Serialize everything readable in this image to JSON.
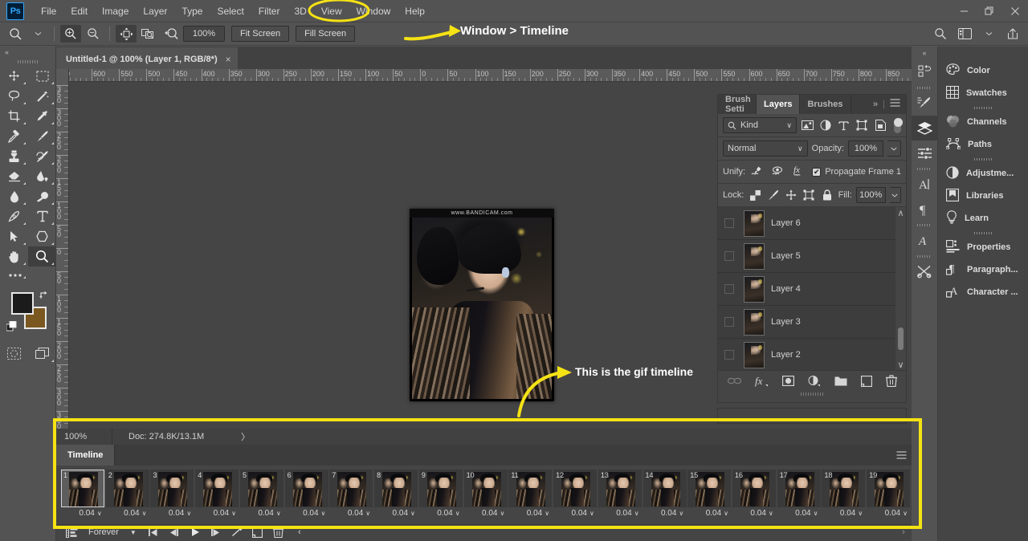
{
  "app": {
    "logo": "Ps"
  },
  "menubar": {
    "items": [
      "File",
      "Edit",
      "Image",
      "Layer",
      "Type",
      "Select",
      "Filter",
      "3D",
      "View",
      "Window",
      "Help"
    ],
    "highlighted": "Window",
    "window_controls": [
      "minimize",
      "restore",
      "close"
    ]
  },
  "options_bar": {
    "tool_icon": "zoom-tool-icon",
    "zoom_in": "zoom-in-icon",
    "zoom_out": "zoom-out-icon",
    "resize_windows": "resize-windows-icon",
    "zoom_all_windows": "zoom-all-windows-icon",
    "scrubby_zoom": "scrubby-zoom-icon",
    "zoom_value": "100%",
    "fit_screen": "Fit Screen",
    "fill_screen": "Fill Screen",
    "right_icons": [
      "search-icon",
      "workspace-icon",
      "chevron-down-icon",
      "share-icon"
    ]
  },
  "toolbar": {
    "collapse": "«",
    "tools": [
      "move-tool-icon",
      "marquee-tool-icon",
      "lasso-tool-icon",
      "magic-wand-tool-icon",
      "crop-tool-icon",
      "eyedropper-tool-icon",
      "healing-brush-tool-icon",
      "brush-tool-icon",
      "clone-stamp-tool-icon",
      "history-brush-tool-icon",
      "eraser-tool-icon",
      "gradient-tool-icon",
      "blur-tool-icon",
      "dodge-tool-icon",
      "pen-tool-icon",
      "type-tool-icon",
      "path-selection-tool-icon",
      "shape-tool-icon",
      "hand-tool-icon",
      "zoom-tool-icon"
    ],
    "active_tool": "zoom-tool-icon",
    "more_tools": "edit-toolbar-icon",
    "foreground_color": "#1b1b1b",
    "background_color": "#7b5820",
    "quick_mask": "quick-mask-icon",
    "screen_mode": "screen-mode-icon"
  },
  "document": {
    "tab_title": "Untitled-1 @ 100% (Layer 1, RGB/8*)",
    "close_label": "×",
    "ruler_h_labels": [
      "0",
      "600",
      "550",
      "500",
      "450",
      "400",
      "350",
      "300",
      "250",
      "200",
      "150",
      "100",
      "50",
      "0",
      "50",
      "100",
      "150",
      "200",
      "250",
      "300",
      "350",
      "400",
      "450",
      "500",
      "550",
      "600",
      "650",
      "700",
      "750",
      "800",
      "850"
    ],
    "ruler_v_labels": [
      "350",
      "300",
      "250",
      "200",
      "150",
      "100",
      "50",
      "0",
      "50",
      "100",
      "150",
      "200",
      "250",
      "300",
      "350",
      "400"
    ],
    "watermark": "www.BANDICAM.com"
  },
  "layers_panel": {
    "tabs": [
      {
        "label": "Brush Setti",
        "active": false
      },
      {
        "label": "Layers",
        "active": true
      },
      {
        "label": "Brushes",
        "active": false
      }
    ],
    "overflow": "»",
    "menu_icon": "panel-menu-icon",
    "filter": {
      "search_icon": "search-icon",
      "kind_label": "Kind",
      "caret": "∨",
      "icons": [
        "filter-pixel-icon",
        "filter-adjustment-icon",
        "filter-type-icon",
        "filter-shape-icon",
        "filter-smart-object-icon"
      ],
      "toggle": "filter-enable-toggle"
    },
    "blend": {
      "mode": "Normal",
      "caret": "∨",
      "opacity_label": "Opacity:",
      "opacity_value": "100%"
    },
    "unify": {
      "label": "Unify:",
      "icons": [
        "unify-position-icon",
        "unify-visibility-icon",
        "unify-style-icon"
      ],
      "propagate_checked": true,
      "propagate_label": "Propagate Frame 1",
      "check_glyph": "✔"
    },
    "lock": {
      "label": "Lock:",
      "icons": [
        "lock-transparent-pixels-icon",
        "lock-image-pixels-icon",
        "lock-position-icon",
        "lock-artboard-nesting-icon",
        "lock-all-icon"
      ],
      "fill_label": "Fill:",
      "fill_value": "100%"
    },
    "layers": [
      {
        "name": "Layer 6",
        "selected": false
      },
      {
        "name": "Layer 5",
        "selected": false
      },
      {
        "name": "Layer 4",
        "selected": false
      },
      {
        "name": "Layer 3",
        "selected": false
      },
      {
        "name": "Layer 2",
        "selected": false
      },
      {
        "name": "",
        "selected": true
      }
    ],
    "footer_icons": [
      "link-layers-icon",
      "layer-style-fx-icon",
      "layer-mask-icon",
      "adjustment-layer-icon",
      "new-group-icon",
      "new-layer-icon",
      "delete-layer-icon"
    ],
    "scroll_up": "∧",
    "scroll_down": "∨"
  },
  "right_dock": {
    "collapse": "«",
    "icon_rail": [
      "history-icon",
      "brush-settings-icon",
      "layers-icon",
      "adjustments-icon",
      "character-icon",
      "paragraph-icon",
      "glyphs-icon",
      "tool-presets-icon"
    ],
    "active_rail_icon": "layers-icon",
    "items": [
      {
        "label": "Color",
        "icon": "color-palette-icon"
      },
      {
        "label": "Swatches",
        "icon": "swatches-grid-icon"
      },
      {
        "label": "Channels",
        "icon": "channels-icon"
      },
      {
        "label": "Paths",
        "icon": "paths-icon"
      },
      {
        "label": "Adjustme...",
        "icon": "adjustments-icon"
      },
      {
        "label": "Libraries",
        "icon": "libraries-icon"
      },
      {
        "label": "Learn",
        "icon": "learn-bulb-icon"
      },
      {
        "label": "Properties",
        "icon": "properties-icon"
      },
      {
        "label": "Paragraph...",
        "icon": "paragraph-styles-icon"
      },
      {
        "label": "Character ...",
        "icon": "character-styles-icon"
      }
    ]
  },
  "status_bar": {
    "zoom": "100%",
    "doc_info": "Doc: 274.8K/13.1M",
    "expand_caret": "〉"
  },
  "timeline": {
    "tab_label": "Timeline",
    "menu_icon": "panel-menu-icon",
    "frames": [
      {
        "number": "1",
        "delay": "0.04",
        "selected": true
      },
      {
        "number": "2",
        "delay": "0.04",
        "selected": false
      },
      {
        "number": "3",
        "delay": "0.04",
        "selected": false
      },
      {
        "number": "4",
        "delay": "0.04",
        "selected": false
      },
      {
        "number": "5",
        "delay": "0.04",
        "selected": false
      },
      {
        "number": "6",
        "delay": "0.04",
        "selected": false
      },
      {
        "number": "7",
        "delay": "0.04",
        "selected": false
      },
      {
        "number": "8",
        "delay": "0.04",
        "selected": false
      },
      {
        "number": "9",
        "delay": "0.04",
        "selected": false
      },
      {
        "number": "10",
        "delay": "0.04",
        "selected": false
      },
      {
        "number": "11",
        "delay": "0.04",
        "selected": false
      },
      {
        "number": "12",
        "delay": "0.04",
        "selected": false
      },
      {
        "number": "13",
        "delay": "0.04",
        "selected": false
      },
      {
        "number": "14",
        "delay": "0.04",
        "selected": false
      },
      {
        "number": "15",
        "delay": "0.04",
        "selected": false
      },
      {
        "number": "16",
        "delay": "0.04",
        "selected": false
      },
      {
        "number": "17",
        "delay": "0.04",
        "selected": false
      },
      {
        "number": "18",
        "delay": "0.04",
        "selected": false
      },
      {
        "number": "19",
        "delay": "0.04",
        "selected": false
      }
    ],
    "delay_caret": "∨",
    "controls": {
      "convert_icon": "convert-to-video-timeline-icon",
      "loop_value": "Forever",
      "loop_caret": "▼",
      "first_frame": "select-first-frame-icon",
      "previous_frame": "select-previous-frame-icon",
      "play": "play-animation-icon",
      "next_frame": "select-next-frame-icon",
      "tween": "tween-frames-icon",
      "duplicate": "duplicate-frame-icon",
      "delete": "delete-frame-icon",
      "scroll": "‹"
    }
  },
  "annotations": {
    "accent_color": "#f5e214",
    "window_timeline": "Window > Timeline",
    "gif_timeline": "This is the gif timeline",
    "highlight_menu_item": "Window"
  }
}
